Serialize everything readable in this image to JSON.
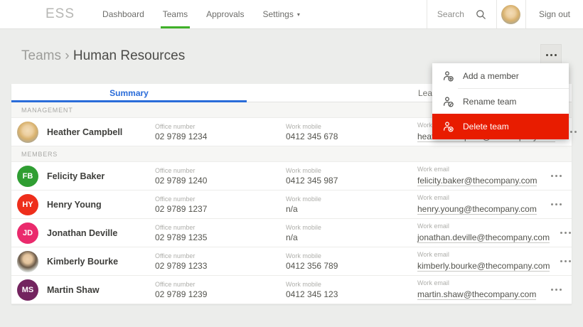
{
  "app": {
    "logo": "ESS"
  },
  "nav": {
    "items": [
      {
        "label": "Dashboard",
        "active": false
      },
      {
        "label": "Teams",
        "active": true
      },
      {
        "label": "Approvals",
        "active": false
      },
      {
        "label": "Settings",
        "active": false,
        "caret": "▾"
      }
    ]
  },
  "header_right": {
    "search_label": "Search",
    "sign_out_label": "Sign out"
  },
  "breadcrumb": {
    "parent": "Teams",
    "separator": "›",
    "current": "Human Resources"
  },
  "tabs": [
    {
      "label": "Summary",
      "active": true
    },
    {
      "label": "Leave",
      "active": false
    }
  ],
  "menu": {
    "items": [
      {
        "label": "Add a member",
        "icon": "person-add-icon",
        "danger": false
      },
      {
        "label": "Rename team",
        "icon": "person-rename-icon",
        "danger": false
      },
      {
        "label": "Delete team",
        "icon": "person-delete-icon",
        "danger": true
      }
    ],
    "danger_color": "#e81c00"
  },
  "colors": {
    "accent_blue": "#2a6cd9",
    "accent_green": "#3fb129",
    "danger_red": "#e81c00"
  },
  "table": {
    "field_labels": {
      "office": "Office number",
      "mobile": "Work mobile",
      "email": "Work email"
    },
    "sections": [
      {
        "label": "MANAGEMENT",
        "rows": [
          {
            "name": "Heather Campbell",
            "avatar": {
              "type": "photo",
              "variant": "blonde"
            },
            "office": "02 9789 1234",
            "mobile": "0412 345 678",
            "email": "heather.campbell@thecompany.com"
          }
        ]
      },
      {
        "label": "MEMBERS",
        "rows": [
          {
            "name": "Felicity Baker",
            "avatar": {
              "type": "initials",
              "text": "FB",
              "color": "#2f9e32"
            },
            "office": "02 9789 1240",
            "mobile": "0412 345 987",
            "email": "felicity.baker@thecompany.com"
          },
          {
            "name": "Henry Young",
            "avatar": {
              "type": "initials",
              "text": "HY",
              "color": "#ee2e1b"
            },
            "office": "02 9789 1237",
            "mobile": "n/a",
            "email": "henry.young@thecompany.com"
          },
          {
            "name": "Jonathan Deville",
            "avatar": {
              "type": "initials",
              "text": "JD",
              "color": "#ea2a6c"
            },
            "office": "02 9789 1235",
            "mobile": "n/a",
            "email": "jonathan.deville@thecompany.com"
          },
          {
            "name": "Kimberly Bourke",
            "avatar": {
              "type": "photo",
              "variant": "dark"
            },
            "office": "02 9789 1233",
            "mobile": "0412 356 789",
            "email": "kimberly.bourke@thecompany.com"
          },
          {
            "name": "Martin Shaw",
            "avatar": {
              "type": "initials",
              "text": "MS",
              "color": "#73245f"
            },
            "office": "02 9789 1239",
            "mobile": "0412 345 123",
            "email": "martin.shaw@thecompany.com"
          }
        ]
      }
    ]
  }
}
